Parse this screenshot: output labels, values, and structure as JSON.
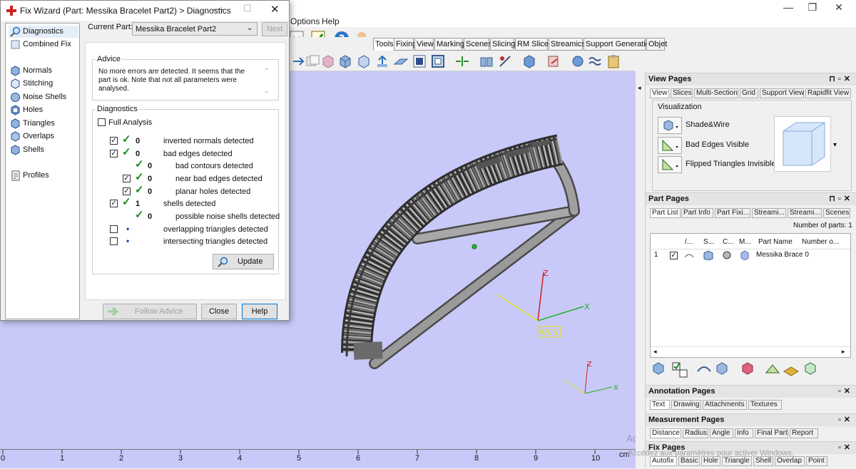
{
  "app": {
    "menu": [
      "Options",
      "Help"
    ],
    "tool_tabs": [
      "Tools",
      "Fixing",
      "View",
      "Marking",
      "Scenes",
      "Slicing",
      "RM Slicer",
      "Streamics",
      "Support Generation",
      "Objet"
    ],
    "active_tool_tab": "Tools"
  },
  "viewport": {
    "axis_labels": {
      "z": "Z",
      "x": "X"
    },
    "wcs_label": "WCS",
    "ruler_numbers": [
      "0",
      "1",
      "2",
      "3",
      "4",
      "5",
      "6",
      "7",
      "8",
      "9",
      "10"
    ],
    "ruler_unit": "cm"
  },
  "wizard": {
    "title": "Fix Wizard (Part: Messika Bracelet Part2) > Diagnostics",
    "current_part_label": "Current Part:",
    "current_part_value": "Messika Bracelet Part2",
    "next_label": "Next",
    "nav": [
      "Diagnostics",
      "Combined Fix",
      "Normals",
      "Stitching",
      "Noise Shells",
      "Holes",
      "Triangles",
      "Overlaps",
      "Shells",
      "Profiles"
    ],
    "advice_title": "Advice",
    "advice_text": "No more errors are detected. It seems that the part is ok. Note that not all parameters were analysed.",
    "diagnostics_title": "Diagnostics",
    "full_analysis_label": "Full Analysis",
    "rows": [
      {
        "checked": true,
        "count": "0",
        "label": "inverted normals detected",
        "indent": 0,
        "ok": true
      },
      {
        "checked": true,
        "count": "0",
        "label": "bad edges detected",
        "indent": 0,
        "ok": true
      },
      {
        "checked": null,
        "count": "0",
        "label": "bad contours detected",
        "indent": 1,
        "ok": true
      },
      {
        "checked": true,
        "count": "0",
        "label": "near bad edges detected",
        "indent": 1,
        "ok": true
      },
      {
        "checked": true,
        "count": "0",
        "label": "planar holes detected",
        "indent": 1,
        "ok": true
      },
      {
        "checked": true,
        "count": "1",
        "label": "shells detected",
        "indent": 0,
        "ok": true
      },
      {
        "checked": null,
        "count": "0",
        "label": "possible noise shells detected",
        "indent": 1,
        "ok": true
      },
      {
        "checked": false,
        "count": "",
        "label": "overlapping triangles detected",
        "indent": 0,
        "ok": false
      },
      {
        "checked": false,
        "count": "",
        "label": "intersecting triangles detected",
        "indent": 0,
        "ok": false
      }
    ],
    "update_label": "Update",
    "follow_advice_label": "Follow Advice",
    "close_label": "Close",
    "help_label": "Help"
  },
  "view_pages": {
    "title": "View Pages",
    "tabs": [
      "View",
      "Slices",
      "Multi-Section",
      "Grid",
      "Support View",
      "Rapidfit View"
    ],
    "visualization_label": "Visualization",
    "items": [
      "Shade&Wire",
      "Bad Edges Visible",
      "Flipped Triangles Invisible"
    ]
  },
  "part_pages": {
    "title": "Part Pages",
    "tabs": [
      "Part List",
      "Part Info",
      "Part Fixi...",
      "Streami...",
      "Streami...",
      "Scenes"
    ],
    "number_of_parts_label": "Number of parts: 1",
    "columns": [
      "/...",
      "S...",
      "C...",
      "M...",
      "Part Name",
      "Number o..."
    ],
    "rows": [
      {
        "index": "1",
        "name": "Messika Brace 0"
      }
    ]
  },
  "annotation_pages": {
    "title": "Annotation Pages",
    "tabs": [
      "Text",
      "Drawing",
      "Attachments",
      "Textures"
    ]
  },
  "measurement_pages": {
    "title": "Measurement Pages",
    "tabs": [
      "Distance",
      "Radius",
      "Angle",
      "Info",
      "Final Part",
      "Report"
    ]
  },
  "fix_pages": {
    "title": "Fix Pages",
    "tabs": [
      "Autofix",
      "Basic",
      "Hole",
      "Triangle",
      "Shell",
      "Overlap",
      "Point"
    ]
  },
  "watermark": {
    "line1": "Activer Windows",
    "line2": "Accédez aux paramètres pour activer Windows."
  },
  "colors": {
    "viewport_bg": "#c8c9f8",
    "ok_green": "#1b8a1b",
    "accent_blue": "#0078d7"
  }
}
